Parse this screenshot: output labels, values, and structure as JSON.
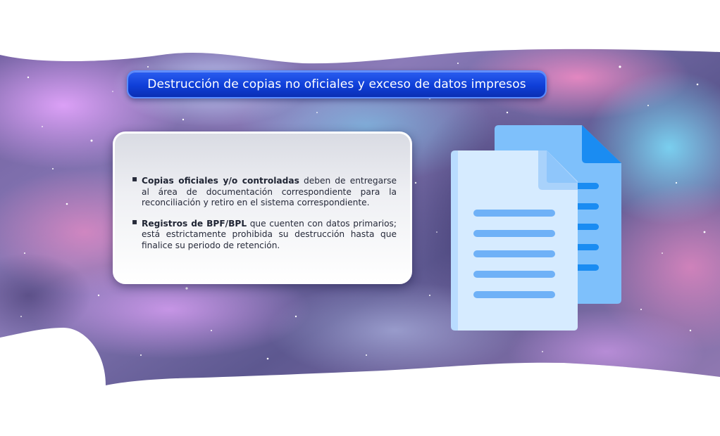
{
  "title": "Destrucción de copias no oficiales y exceso de datos impresos",
  "card": {
    "items": [
      {
        "bold": "Copias oficiales y/o controladas",
        "text": " deben de entregarse al área de documentación correspondiente para la reconciliación y retiro en el sistema correspondiente."
      },
      {
        "bold": "Registros de BPF/BPL",
        "text": " que cuenten con datos primarios; está estrictamente prohibida su destrucción hasta que finalice su periodo de retención."
      }
    ]
  },
  "icons": {
    "illustration": "documents-icon"
  },
  "colors": {
    "title_pill": "#1a4be6",
    "doc_back": "#7ec0fb",
    "doc_front": "#d6ebff",
    "doc_lines": "#6fb1f7",
    "doc_back_lines": "#1a8cf2"
  }
}
